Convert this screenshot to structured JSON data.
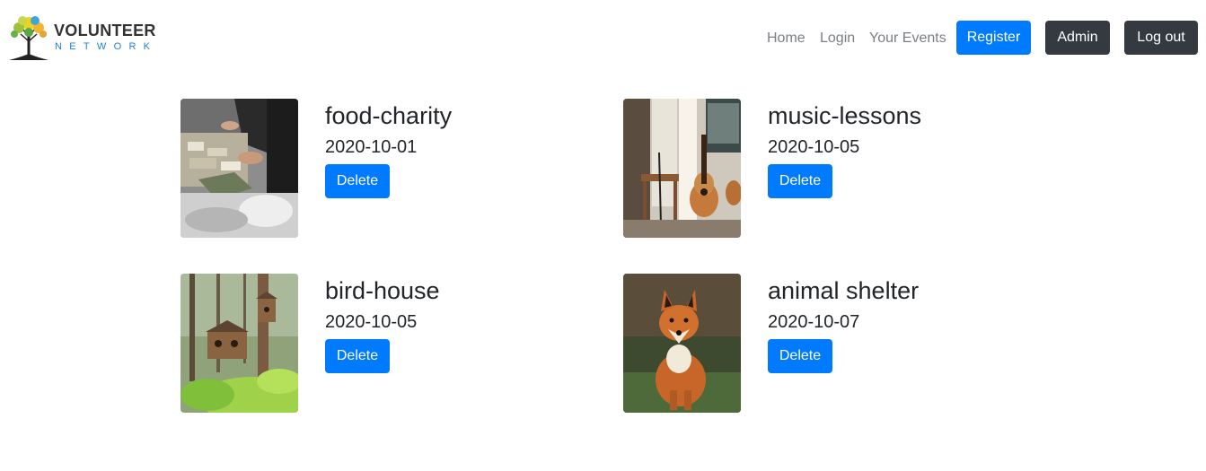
{
  "brand": {
    "title": "VOLUNTEER",
    "subtitle": "NETWORK"
  },
  "nav": {
    "home": "Home",
    "login": "Login",
    "your_events": "Your Events",
    "register": "Register",
    "admin": "Admin",
    "logout": "Log out"
  },
  "colors": {
    "primary": "#007bff",
    "dark": "#343a40",
    "text": "#212529",
    "nav_text": "#7b7f83"
  },
  "events": [
    {
      "title": "food-charity",
      "date": "2020-10-01",
      "delete_label": "Delete"
    },
    {
      "title": "music-lessons",
      "date": "2020-10-05",
      "delete_label": "Delete"
    },
    {
      "title": "bird-house",
      "date": "2020-10-05",
      "delete_label": "Delete"
    },
    {
      "title": "animal shelter",
      "date": "2020-10-07",
      "delete_label": "Delete"
    }
  ]
}
